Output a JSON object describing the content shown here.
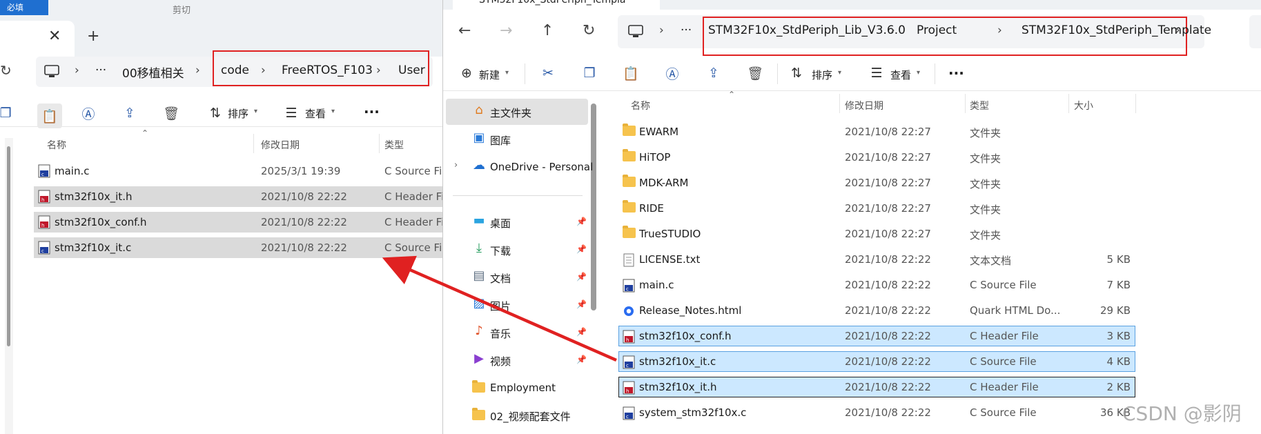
{
  "left_window": {
    "top_strip_label": "必填",
    "top_strip_cut_label": "剪切",
    "address": {
      "pre_crumbs": [
        "···",
        "00移植相关"
      ],
      "boxed_crumbs": [
        "code",
        "FreeRTOS_F103",
        "User"
      ]
    },
    "toolbar": {
      "sort_label": "排序",
      "view_label": "查看",
      "more_label": "···"
    },
    "columns": {
      "name": "名称",
      "date": "修改日期",
      "type": "类型"
    },
    "files": [
      {
        "name": "main.c",
        "date": "2025/3/1 19:39",
        "type": "C Source Fi",
        "icon": "c-source-file-icon",
        "selected": false
      },
      {
        "name": "stm32f10x_it.h",
        "date": "2021/10/8 22:22",
        "type": "C Header Fi",
        "icon": "c-header-file-icon",
        "selected": true
      },
      {
        "name": "stm32f10x_conf.h",
        "date": "2021/10/8 22:22",
        "type": "C Header Fi",
        "icon": "c-header-file-icon",
        "selected": true
      },
      {
        "name": "stm32f10x_it.c",
        "date": "2021/10/8 22:22",
        "type": "C Source Fi",
        "icon": "c-source-file-icon",
        "selected": true
      }
    ]
  },
  "right_window": {
    "tab_title": "STM32F10x_StdPeriph_Templa",
    "address": {
      "pre_crumbs": [
        "···"
      ],
      "boxed_crumbs": [
        "STM32F10x_StdPeriph_Lib_V3.6.0",
        "Project",
        "STM32F10x_StdPeriph_Template"
      ]
    },
    "toolbar": {
      "new_label": "新建",
      "sort_label": "排序",
      "view_label": "查看",
      "more_label": "···"
    },
    "nav": [
      {
        "label": "主文件夹",
        "icon": "home-icon",
        "active": true,
        "pinned": false
      },
      {
        "label": "图库",
        "icon": "gallery-icon",
        "active": false,
        "pinned": false
      },
      {
        "label": "OneDrive - Personal",
        "icon": "cloud-icon",
        "active": false,
        "pinned": false
      },
      {
        "label": "桌面",
        "icon": "desktop-icon",
        "active": false,
        "pinned": true
      },
      {
        "label": "下载",
        "icon": "download-icon",
        "active": false,
        "pinned": true
      },
      {
        "label": "文档",
        "icon": "document-icon",
        "active": false,
        "pinned": true
      },
      {
        "label": "图片",
        "icon": "pictures-icon",
        "active": false,
        "pinned": true
      },
      {
        "label": "音乐",
        "icon": "music-icon",
        "active": false,
        "pinned": true
      },
      {
        "label": "视频",
        "icon": "video-icon",
        "active": false,
        "pinned": true
      },
      {
        "label": "Employment",
        "icon": "folder-icon",
        "active": false,
        "pinned": false
      },
      {
        "label": "02_视频配套文件",
        "icon": "folder-icon",
        "active": false,
        "pinned": false
      }
    ],
    "columns": {
      "name": "名称",
      "date": "修改日期",
      "type": "类型",
      "size": "大小"
    },
    "files": [
      {
        "name": "EWARM",
        "date": "2021/10/8 22:27",
        "type": "文件夹",
        "size": "",
        "icon": "folder-icon",
        "selected": false
      },
      {
        "name": "HiTOP",
        "date": "2021/10/8 22:27",
        "type": "文件夹",
        "size": "",
        "icon": "folder-icon",
        "selected": false
      },
      {
        "name": "MDK-ARM",
        "date": "2021/10/8 22:27",
        "type": "文件夹",
        "size": "",
        "icon": "folder-icon",
        "selected": false
      },
      {
        "name": "RIDE",
        "date": "2021/10/8 22:27",
        "type": "文件夹",
        "size": "",
        "icon": "folder-icon",
        "selected": false
      },
      {
        "name": "TrueSTUDIO",
        "date": "2021/10/8 22:27",
        "type": "文件夹",
        "size": "",
        "icon": "folder-icon",
        "selected": false
      },
      {
        "name": "LICENSE.txt",
        "date": "2021/10/8 22:22",
        "type": "文本文档",
        "size": "5 KB",
        "icon": "text-file-icon",
        "selected": false
      },
      {
        "name": "main.c",
        "date": "2021/10/8 22:22",
        "type": "C Source File",
        "size": "7 KB",
        "icon": "c-source-file-icon",
        "selected": false
      },
      {
        "name": "Release_Notes.html",
        "date": "2021/10/8 22:22",
        "type": "Quark HTML Do...",
        "size": "29 KB",
        "icon": "html-file-icon",
        "selected": false
      },
      {
        "name": "stm32f10x_conf.h",
        "date": "2021/10/8 22:22",
        "type": "C Header File",
        "size": "3 KB",
        "icon": "c-header-file-icon",
        "selected": true
      },
      {
        "name": "stm32f10x_it.c",
        "date": "2021/10/8 22:22",
        "type": "C Source File",
        "size": "4 KB",
        "icon": "c-source-file-icon",
        "selected": true
      },
      {
        "name": "stm32f10x_it.h",
        "date": "2021/10/8 22:22",
        "type": "C Header File",
        "size": "2 KB",
        "icon": "c-header-file-icon",
        "selected": true
      },
      {
        "name": "system_stm32f10x.c",
        "date": "2021/10/8 22:22",
        "type": "C Source File",
        "size": "36 KB",
        "icon": "c-source-file-icon",
        "selected": false
      }
    ]
  },
  "annotation": {
    "arrow_color": "#e02121",
    "box_color": "#e02121"
  },
  "watermark": "CSDN @影阴"
}
